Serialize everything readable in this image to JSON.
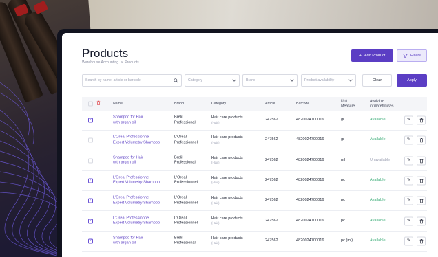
{
  "page": {
    "title": "Products",
    "breadcrumbs": [
      "Warehouse Accounting",
      ">",
      "Products"
    ],
    "add_button": "Add Product",
    "filters_button": "Filters"
  },
  "filters": {
    "search_placeholder": "Search by name, article or barcode",
    "category_placeholder": "Category",
    "brand_placeholder": "Brand",
    "availability_placeholder": "Product availability",
    "clear_label": "Clear",
    "apply_label": "Apply"
  },
  "table": {
    "headers": {
      "name": "Name",
      "brand": "Brand",
      "category": "Category",
      "article": "Article",
      "barcode": "Barcode",
      "unit_measure": "Unit\nMeasure",
      "available": "Available\nin Warehouses"
    },
    "rows": [
      {
        "checked": true,
        "name": "Shampoo for Hair\nwith argan oil",
        "brand": "Brelil\nProfessional",
        "category": "Hair care products",
        "category_sub": "(Hair)",
        "article": "247562",
        "barcode": "4820024700016",
        "unit": "gr",
        "availability": "Available"
      },
      {
        "checked": false,
        "name": "L'Oreal Professionnel\nExpert Volumetry Shampoo",
        "brand": "L'Oreal\nProfessionnel",
        "category": "Hair care products",
        "category_sub": "(Hair)",
        "article": "247562",
        "barcode": "4820024700016",
        "unit": "gr",
        "availability": "Available"
      },
      {
        "checked": false,
        "name": "Shampoo for Hair\nwith argan oil",
        "brand": "Brelil\nProfessional",
        "category": "Hair care products",
        "category_sub": "(Hair)",
        "article": "247562",
        "barcode": "4820024700016",
        "unit": "ml",
        "availability": "Unavailable"
      },
      {
        "checked": true,
        "name": "L'Oreal Professionnel\nExpert Volumetry Shampoo",
        "brand": "L'Oreal\nProfessionnel",
        "category": "Hair care products",
        "category_sub": "(Hair)",
        "article": "247562",
        "barcode": "4820024700016",
        "unit": "pc",
        "availability": "Available"
      },
      {
        "checked": true,
        "name": "L'Oreal Professionnel\nExpert Volumetry Shampoo",
        "brand": "L'Oreal\nProfessionnel",
        "category": "Hair care products",
        "category_sub": "(Hair)",
        "article": "247562",
        "barcode": "4820024700016",
        "unit": "pc",
        "availability": "Available"
      },
      {
        "checked": true,
        "name": "L'Oreal Professionnel\nExpert Volumetry Shampoo",
        "brand": "L'Oreal\nProfessionnel",
        "category": "Hair care products",
        "category_sub": "(Hair)",
        "article": "247562",
        "barcode": "4820024700016",
        "unit": "pc",
        "availability": "Available"
      },
      {
        "checked": true,
        "name": "Shampoo for Hair\nwith argan oil",
        "brand": "Brelil\nProfessional",
        "category": "Hair care products",
        "category_sub": "(Hair)",
        "article": "247562",
        "barcode": "4820024700016",
        "unit": "pc (ml)",
        "availability": "Available"
      }
    ]
  },
  "colors": {
    "accent": "#5b3ec4",
    "available": "#3fae7a",
    "delete": "#e0474c"
  },
  "icons": {
    "edit": "pencil-icon",
    "delete": "trash-icon",
    "search": "search-icon",
    "dropdown": "chevron-down-icon",
    "filter": "funnel-icon",
    "add": "plus-icon"
  }
}
